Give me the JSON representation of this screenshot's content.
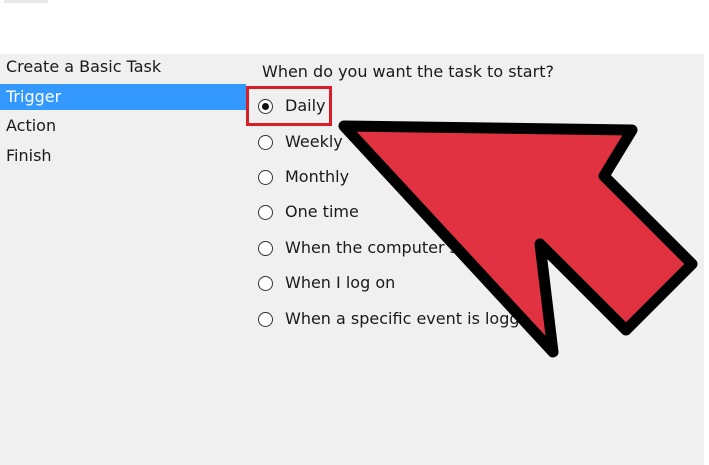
{
  "wizard": {
    "steps": [
      {
        "label": "Create a Basic Task",
        "active": false
      },
      {
        "label": "Trigger",
        "active": true
      },
      {
        "label": "Action",
        "active": false
      },
      {
        "label": "Finish",
        "active": false
      }
    ]
  },
  "trigger": {
    "question": "When do you want the task to start?",
    "options": [
      {
        "label": "Daily",
        "selected": true
      },
      {
        "label": "Weekly",
        "selected": false
      },
      {
        "label": "Monthly",
        "selected": false
      },
      {
        "label": "One time",
        "selected": false
      },
      {
        "label": "When the computer s",
        "selected": false
      },
      {
        "label": "When I log on",
        "selected": false
      },
      {
        "label": "When a specific event is logge",
        "selected": false
      }
    ]
  },
  "annotations": {
    "highlight_color": "#d91e2a",
    "arrow_color": "#e03240",
    "arrow_outline_color": "#000000",
    "arrow_icon": "pointer-arrow-icon"
  },
  "colors": {
    "selection": "#3399ff",
    "background": "#f0f0f0"
  }
}
